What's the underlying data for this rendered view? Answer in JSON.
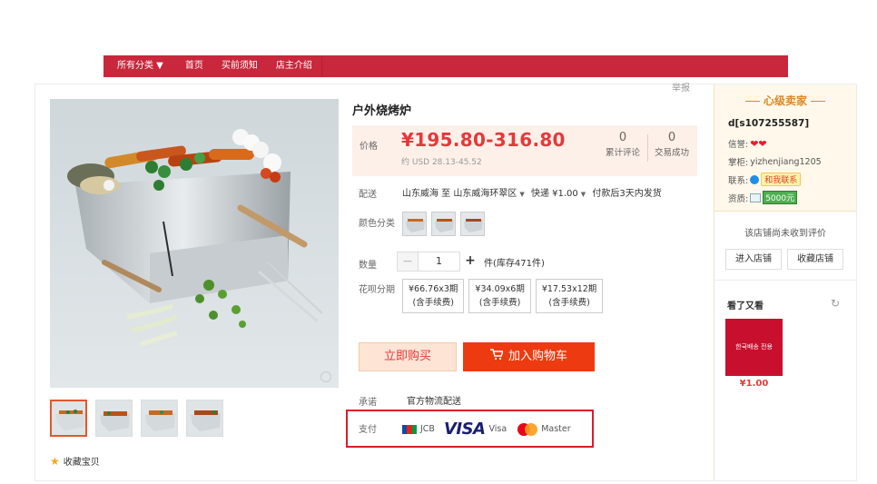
{
  "nav": {
    "items": [
      "所有分类 ▼",
      "首页",
      "买前须知",
      "店主介绍"
    ]
  },
  "product": {
    "title": "户外烧烤炉",
    "report_label": "举报",
    "price_label": "价格",
    "price": "¥195.80-316.80",
    "usd": "约 USD 28.13-45.52",
    "stats": [
      {
        "num": "0",
        "label": "累计评论"
      },
      {
        "num": "0",
        "label": "交易成功"
      }
    ],
    "delivery_label": "配送",
    "delivery_from": "山东威海 至",
    "delivery_to": "山东威海环翠区",
    "delivery_fee": "快递 ¥1.00",
    "delivery_note": "付款后3天内发货",
    "color_label": "颜色分类",
    "qty_label": "数量",
    "qty_value": "1",
    "qty_minus": "−",
    "qty_plus": "+",
    "stock": "件(库存471件)",
    "installment_label": "花呗分期",
    "installments": [
      {
        "amount": "¥66.76x3期",
        "note": "(含手续费)"
      },
      {
        "amount": "¥34.09x6期",
        "note": "(含手续费)"
      },
      {
        "amount": "¥17.53x12期",
        "note": "(含手续费)"
      }
    ],
    "buy_now": "立即购买",
    "add_cart": "加入购物车",
    "promise_label": "承诺",
    "promise_value": "官方物流配送",
    "pay_label": "支付",
    "payments": [
      "JCB",
      "VISA",
      "Visa",
      "Master"
    ],
    "favorite": "收藏宝贝"
  },
  "seller": {
    "title": "心级卖家",
    "name": "d[s107255587]",
    "credit_label": "信誉:",
    "owner_label": "掌柜:",
    "owner": "yizhenjiang1205",
    "contact_label": "联系:",
    "contact_btn": "和我联系",
    "qualification_label": "资质:",
    "deposit": "5000元",
    "no_review": "该店铺尚未收到评价",
    "enter_shop": "进入店铺",
    "fav_shop": "收藏店铺",
    "see_also": "看了又看",
    "rec_img_text": "한국배송 전용",
    "rec_price": "¥1.00"
  },
  "colors": {
    "nav_bg": "#c9273c",
    "price": "#e4393c",
    "add_cart_bg": "#ee3a10",
    "highlight_border": "#e0182d"
  }
}
